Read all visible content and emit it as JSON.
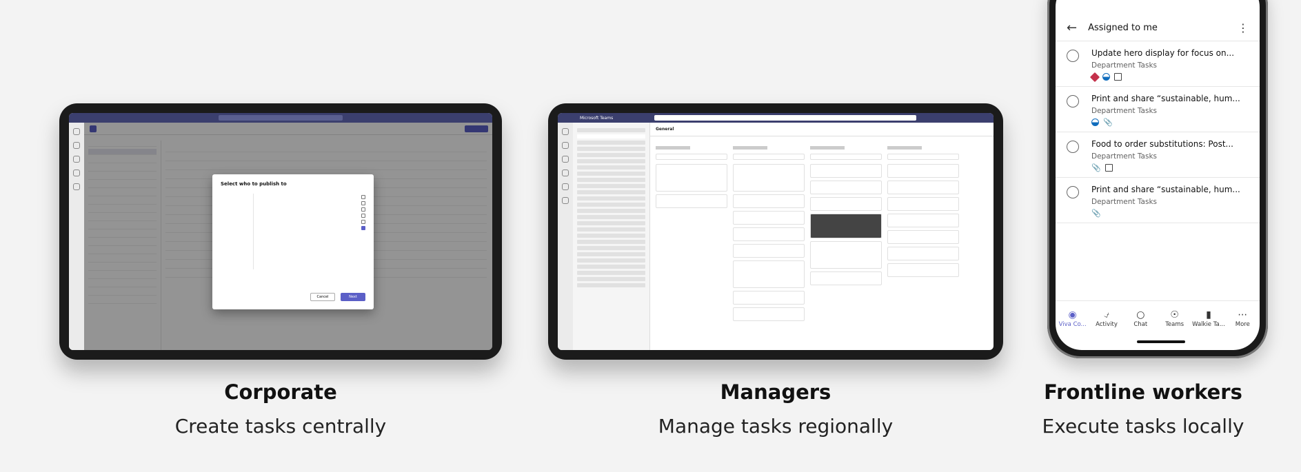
{
  "corporate": {
    "title": "Corporate",
    "subtitle": "Create tasks centrally",
    "dialog_title": "Select who to publish to",
    "cancel": "Cancel",
    "next": "Next"
  },
  "managers": {
    "title": "Managers",
    "subtitle": "Manage tasks regionally",
    "brand": "Microsoft Teams",
    "channel": "General"
  },
  "frontline": {
    "title": "Frontline workers",
    "subtitle": "Execute tasks locally",
    "header_title": "Assigned to me",
    "tasks": [
      {
        "title": "Update hero display for focus on...",
        "sub": "Department Tasks"
      },
      {
        "title": "Print and share “sustainable, hum...",
        "sub": "Department Tasks"
      },
      {
        "title": "Food to order substitutions: Post...",
        "sub": "Department Tasks"
      },
      {
        "title": "Print and share “sustainable, hum...",
        "sub": "Department Tasks"
      }
    ],
    "nav": [
      "Viva Co...",
      "Activity",
      "Chat",
      "Teams",
      "Walkie Ta...",
      "More"
    ]
  }
}
